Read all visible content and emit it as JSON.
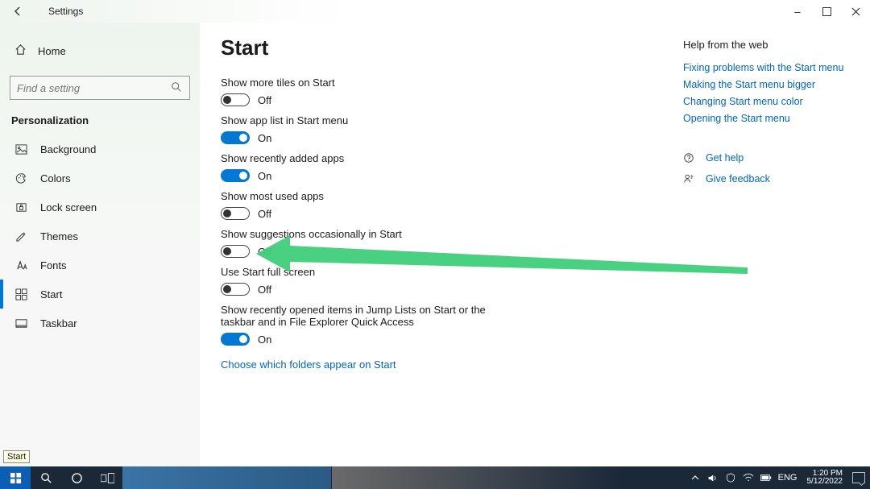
{
  "window": {
    "title": "Settings",
    "min_label": "–",
    "max_label": "▢",
    "close_label": "✕"
  },
  "sidebar": {
    "home_label": "Home",
    "search_placeholder": "Find a setting",
    "category": "Personalization",
    "items": [
      {
        "icon": "picture-icon",
        "label": "Background",
        "selected": false
      },
      {
        "icon": "palette-icon",
        "label": "Colors",
        "selected": false
      },
      {
        "icon": "lock-icon",
        "label": "Lock screen",
        "selected": false
      },
      {
        "icon": "theme-icon",
        "label": "Themes",
        "selected": false
      },
      {
        "icon": "font-icon",
        "label": "Fonts",
        "selected": false
      },
      {
        "icon": "start-icon",
        "label": "Start",
        "selected": true
      },
      {
        "icon": "taskbar-icon",
        "label": "Taskbar",
        "selected": false
      }
    ],
    "tooltip_text": "Start"
  },
  "page": {
    "title": "Start",
    "settings": [
      {
        "label": "Show more tiles on Start",
        "on": false,
        "state": "Off"
      },
      {
        "label": "Show app list in Start menu",
        "on": true,
        "state": "On"
      },
      {
        "label": "Show recently added apps",
        "on": true,
        "state": "On"
      },
      {
        "label": "Show most used apps",
        "on": false,
        "state": "Off"
      },
      {
        "label": "Show suggestions occasionally in Start",
        "on": false,
        "state": "Off"
      },
      {
        "label": "Use Start full screen",
        "on": false,
        "state": "Off"
      },
      {
        "label": "Show recently opened items in Jump Lists on Start or the taskbar and in File Explorer Quick Access",
        "on": true,
        "state": "On"
      }
    ],
    "folders_link": "Choose which folders appear on Start"
  },
  "help": {
    "heading": "Help from the web",
    "links": [
      "Fixing problems with the Start menu",
      "Making the Start menu bigger",
      "Changing Start menu color",
      "Opening the Start menu"
    ],
    "get_help": "Get help",
    "give_feedback": "Give feedback"
  },
  "taskbar": {
    "lang": "ENG",
    "time": "1:20 PM",
    "date": "5/12/2022"
  }
}
